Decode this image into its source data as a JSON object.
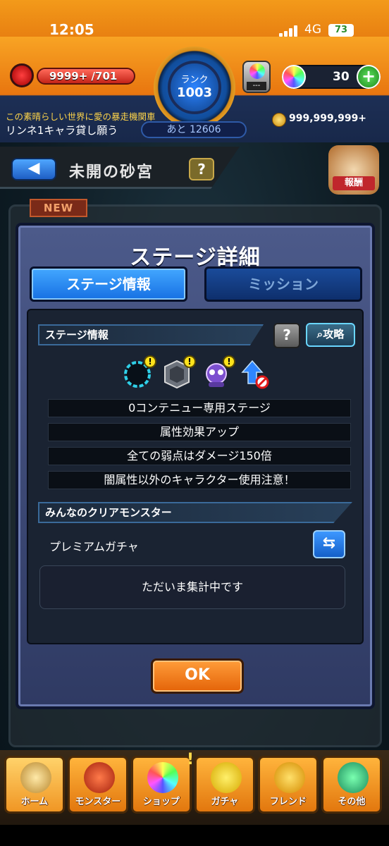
{
  "status_bar": {
    "time": "12:05",
    "network": "4G",
    "battery": "73"
  },
  "header": {
    "stamina_value": "9999+ /701",
    "rank_label": "ランク",
    "rank_value": "1003",
    "next_exp": "あと 12606",
    "stamina_item": "---",
    "orb_count": "30",
    "plus_label": "+",
    "news_line1": "この素晴らしい世界に愛の暴走機関車",
    "news_line2": "リンネ1キャラ貸し願う",
    "gold": "999,999,999+"
  },
  "stage": {
    "name": "未開の砂宮",
    "help": "?",
    "new_badge": "NEW",
    "reward_badge": "報酬"
  },
  "dialog": {
    "title": "ステージ詳細",
    "tabs": [
      {
        "label": "ステージ情報",
        "active": true
      },
      {
        "label": "ミッション",
        "active": false
      }
    ],
    "section_stage_info": "ステージ情報",
    "help": "?",
    "strategy_button": "攻略",
    "gimmick_icons": [
      "black-hole-icon",
      "block-icon",
      "robot-icon",
      "speed-up-icon"
    ],
    "info_lines": [
      "0コンテニュー専用ステージ",
      "属性効果アップ",
      "全ての弱点はダメージ150倍",
      "闇属性以外のキャラクター使用注意！"
    ],
    "section_clear_monsters": "みんなのクリアモンスター",
    "gacha_label": "プレミアムガチャ",
    "tally_message": "ただいま集計中です",
    "ok_button": "OK"
  },
  "nav": [
    {
      "label": "ホーム",
      "icon": "home-icon"
    },
    {
      "label": "モンスター",
      "icon": "monster-icon"
    },
    {
      "label": "ショップ",
      "icon": "shop-icon"
    },
    {
      "label": "ガチャ",
      "icon": "gacha-icon"
    },
    {
      "label": "フレンド",
      "icon": "friend-icon"
    },
    {
      "label": "その他",
      "icon": "other-icon"
    }
  ]
}
